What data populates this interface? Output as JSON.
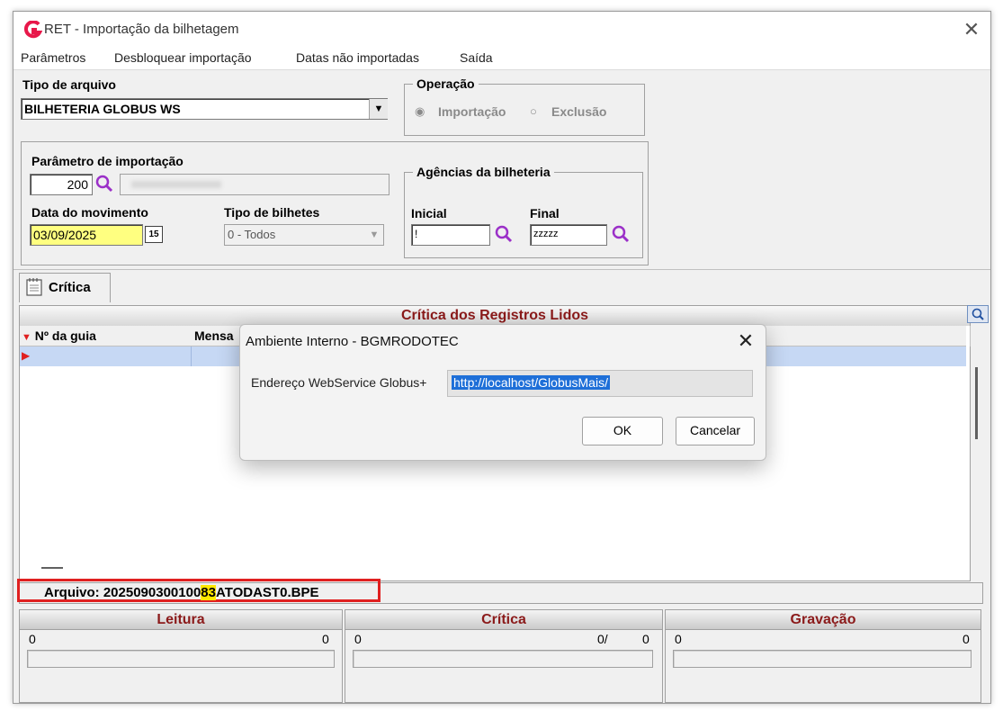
{
  "window": {
    "title": "RET - Importação da bilhetagem"
  },
  "menu": {
    "items": [
      "Parâmetros",
      "Desbloquear importação",
      "Datas não importadas",
      "Saída"
    ]
  },
  "tipo_arquivo": {
    "label": "Tipo de arquivo",
    "value": "BILHETERIA GLOBUS WS"
  },
  "operacao": {
    "title": "Operação",
    "opt_importacao": "Importação",
    "opt_exclusao": "Exclusão",
    "selected": "Importação"
  },
  "parametro": {
    "label": "Parâmetro de importação",
    "code": "200"
  },
  "data_movimento": {
    "label": "Data do movimento",
    "value": "03/09/2025"
  },
  "tipo_bilhetes": {
    "label": "Tipo de bilhetes",
    "value": "0 - Todos"
  },
  "agencias": {
    "title": "Agências da bilheteria",
    "inicial_label": "Inicial",
    "inicial_value": "!",
    "final_label": "Final",
    "final_value": "zzzzz"
  },
  "tab": {
    "label": "Crítica"
  },
  "grid": {
    "title": "Crítica dos Registros Lidos",
    "col_guia": "Nº da guia",
    "col_mensagem": "Mensa"
  },
  "arquivo": {
    "label": "Arquivo:",
    "part1": "2025090300100",
    "highlight": "83",
    "part2": "ATODAST0.BPE"
  },
  "leitura": {
    "title": "Leitura",
    "left": "0",
    "right": "0"
  },
  "critica": {
    "title": "Crítica",
    "left": "0",
    "mid": "0/",
    "right": "0"
  },
  "gravacao": {
    "title": "Gravação",
    "left": "0",
    "right": "0"
  },
  "dialog": {
    "title": "Ambiente Interno - BGMRODOTEC",
    "label": "Endereço WebService Globus+",
    "value": "http://localhost/GlobusMais/",
    "ok": "OK",
    "cancel": "Cancelar"
  },
  "colors": {
    "header_text": "#8b1a1a",
    "accent": "#e8184a",
    "selection": "#c6d8f4",
    "date_bg": "#ffff80",
    "highlight_red": "#e02020",
    "magnifier": "#9b30c8"
  }
}
